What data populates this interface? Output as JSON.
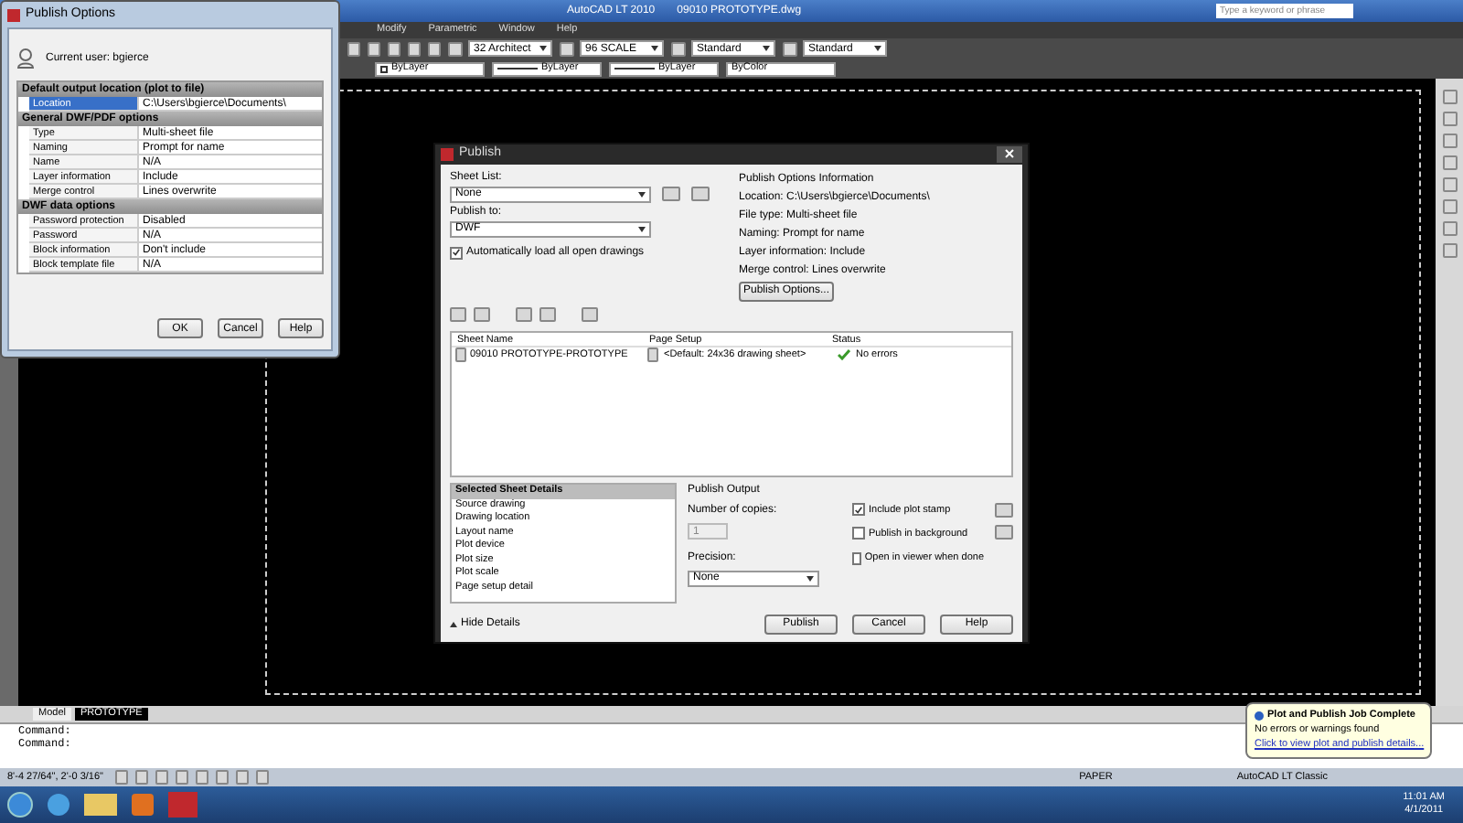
{
  "app_window": {
    "title": "AutoCAD LT 2010",
    "file": "09010 PROTOTYPE.dwg",
    "search": {
      "placeholder": "Type a keyword or phrase"
    }
  },
  "menu": [
    {
      "label": "Modify"
    },
    {
      "label": "Parametric"
    },
    {
      "label": "Window"
    },
    {
      "label": "Help"
    }
  ],
  "toolbar_1": [
    "32 Architect",
    "96 SCALE",
    "Standard",
    "Standard"
  ],
  "toolbar_2": [
    {
      "kind": "color",
      "label": "ByLayer"
    },
    {
      "kind": "linetype",
      "label": "ByLayer"
    },
    {
      "kind": "linetype",
      "label": "ByLayer"
    },
    {
      "kind": "plain",
      "label": "ByColor"
    }
  ],
  "layout_tabs": [
    {
      "label": "Model",
      "selected": false
    },
    {
      "label": "PROTOTYPE",
      "selected": true
    }
  ],
  "command_lines": [
    "Command:",
    "Command:"
  ],
  "status_bar": {
    "coordinates": "8'-4 27/64\", 2'-0 3/16\"",
    "space": "PAPER",
    "workspace": "AutoCAD LT Classic"
  },
  "notification": {
    "title": "Plot and Publish Job Complete",
    "message": "No errors or warnings found",
    "link": "Click to view plot and publish details..."
  },
  "taskbar": {
    "time": "11:01 AM",
    "date": "4/1/2011"
  },
  "publish_options_dialog": {
    "title": "Publish Options",
    "user": "Current user: bgierce",
    "sections": [
      {
        "title": "Default output location (plot to file)",
        "rows": [
          {
            "label": "Location",
            "value": "C:\\Users\\bgierce\\Documents\\",
            "selected": true
          }
        ]
      },
      {
        "title": "General DWF/PDF options",
        "rows": [
          {
            "label": "Type",
            "value": "Multi-sheet file",
            "selected": false
          },
          {
            "label": "Naming",
            "value": "Prompt for name",
            "selected": false
          },
          {
            "label": "Name",
            "value": "N/A",
            "selected": false
          },
          {
            "label": "Layer information",
            "value": "Include",
            "selected": false
          },
          {
            "label": "Merge control",
            "value": "Lines overwrite",
            "selected": false
          }
        ]
      },
      {
        "title": "DWF data options",
        "rows": [
          {
            "label": "Password protection",
            "value": "Disabled",
            "selected": false
          },
          {
            "label": "Password",
            "value": "N/A",
            "selected": false
          },
          {
            "label": "Block information",
            "value": "Don't include",
            "selected": false
          },
          {
            "label": "Block template file",
            "value": "N/A",
            "selected": false
          }
        ]
      }
    ],
    "buttons": [
      "OK",
      "Cancel",
      "Help"
    ]
  },
  "publish_dialog": {
    "title": "Publish",
    "sheet_list": {
      "label": "Sheet List:",
      "value": "None"
    },
    "publish_to": {
      "label": "Publish to:",
      "value": "DWF"
    },
    "auto_load": {
      "label": "Automatically load all open drawings",
      "checked": true
    },
    "info": {
      "title": "Publish Options Information",
      "lines": [
        "Location: C:\\Users\\bgierce\\Documents\\",
        "File type: Multi-sheet file",
        "Naming: Prompt for name",
        "Layer information: Include",
        "Merge control: Lines overwrite"
      ]
    },
    "options_button": "Publish Options...",
    "table": {
      "columns": [
        "Sheet Name",
        "Page Setup",
        "Status"
      ],
      "rows": [
        {
          "sheet": "09010 PROTOTYPE-PROTOTYPE",
          "page_setup": "<Default: 24x36 drawing sheet>",
          "status": "No errors"
        }
      ]
    },
    "details": {
      "title": "Selected Sheet Details",
      "items": [
        "Source drawing",
        "Drawing location",
        "Layout name",
        "Plot device",
        "Plot size",
        "Plot scale",
        "Page setup detail"
      ]
    },
    "output": {
      "title": "Publish Output",
      "copies_label": "Number of copies:",
      "copies": "1",
      "precision_label": "Precision:",
      "precision": "None",
      "options": [
        {
          "label": "Include plot stamp",
          "checked": true
        },
        {
          "label": "Publish in background",
          "checked": false
        },
        {
          "label": "Open in viewer when done",
          "checked": false
        }
      ]
    },
    "hide_details": "Hide Details",
    "buttons": [
      "Publish",
      "Cancel",
      "Help"
    ]
  }
}
